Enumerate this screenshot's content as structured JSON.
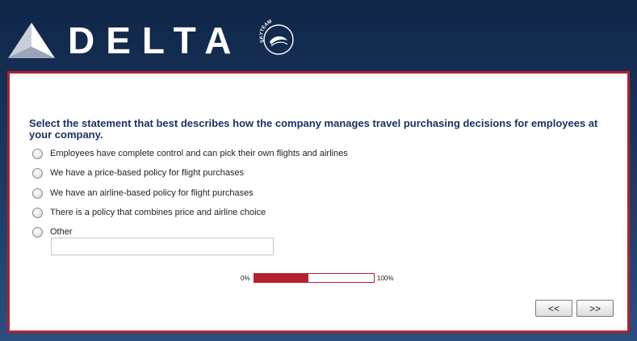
{
  "brand": {
    "wordmark": "DELTA",
    "alliance_mark": "SKYTEAM",
    "logo_icon": "delta-widget-icon",
    "colors": {
      "header_bg": "#1d3a63",
      "accent": "#b5202e",
      "question_text": "#1a3263"
    }
  },
  "survey": {
    "question": "Select the statement that best describes how the company manages travel purchasing decisions for employees at your company.",
    "options": [
      "Employees have complete control and can pick their own flights and airlines",
      "We have a price-based policy for flight purchases",
      "We have an airline-based policy for flight purchases",
      "There is a policy that combines price and airline choice",
      "Other"
    ],
    "other_value": "",
    "progress": {
      "min_label": "0%",
      "max_label": "100%",
      "fraction": 0.45
    },
    "nav": {
      "back_label": "<<",
      "next_label": ">>"
    }
  }
}
